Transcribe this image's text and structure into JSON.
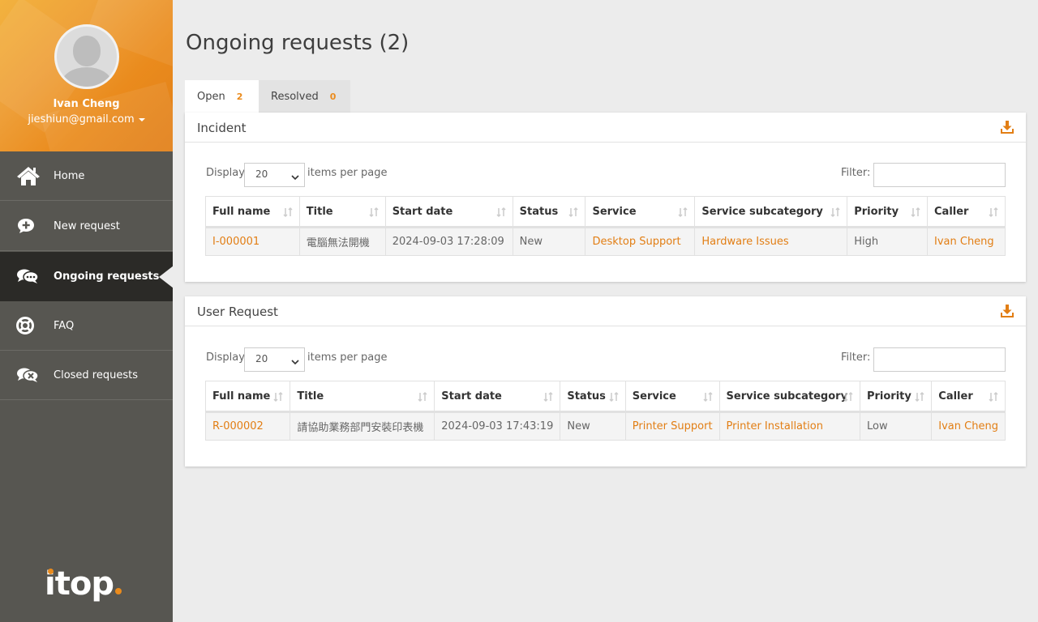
{
  "user": {
    "name": "Ivan Cheng",
    "email": "jieshiun@gmail.com"
  },
  "nav": [
    {
      "label": "Home",
      "icon": "home-icon"
    },
    {
      "label": "New request",
      "icon": "new-request-icon"
    },
    {
      "label": "Ongoing requests",
      "icon": "ongoing-requests-icon",
      "active": true
    },
    {
      "label": "FAQ",
      "icon": "faq-lifebuoy-icon"
    },
    {
      "label": "Closed requests",
      "icon": "closed-requests-icon"
    }
  ],
  "logo": "itop",
  "page_title": "Ongoing requests (2)",
  "tabs": [
    {
      "label": "Open",
      "count": "2",
      "active": true
    },
    {
      "label": "Resolved",
      "count": "0"
    }
  ],
  "incident": {
    "title": "Incident",
    "display_label": "Display",
    "page_size": "20",
    "ipp_label": "items per page",
    "filter_label": "Filter:",
    "columns": [
      "Full name",
      "Title",
      "Start date",
      "Status",
      "Service",
      "Service subcategory",
      "Priority",
      "Caller"
    ],
    "row": {
      "full_name": "I-000001",
      "title": "電腦無法開機",
      "start_date": "2024-09-03 17:28:09",
      "status": "New",
      "service": "Desktop Support",
      "subcategory": "Hardware Issues",
      "priority": "High",
      "caller": "Ivan Cheng"
    }
  },
  "user_request": {
    "title": "User Request",
    "display_label": "Display",
    "page_size": "20",
    "ipp_label": "items per page",
    "filter_label": "Filter:",
    "columns": [
      "Full name",
      "Title",
      "Start date",
      "Status",
      "Service",
      "Service subcategory",
      "Priority",
      "Caller"
    ],
    "row": {
      "full_name": "R-000002",
      "title": "請協助業務部門安裝印表機",
      "start_date": "2024-09-03 17:43:19",
      "status": "New",
      "service": "Printer Support",
      "subcategory": "Printer Installation",
      "priority": "Low",
      "caller": "Ivan Cheng"
    }
  },
  "colors": {
    "accent": "#ea8b1d",
    "sidebar": "#575651",
    "sidebar_active": "#2b2a27",
    "link": "#e27e14"
  }
}
